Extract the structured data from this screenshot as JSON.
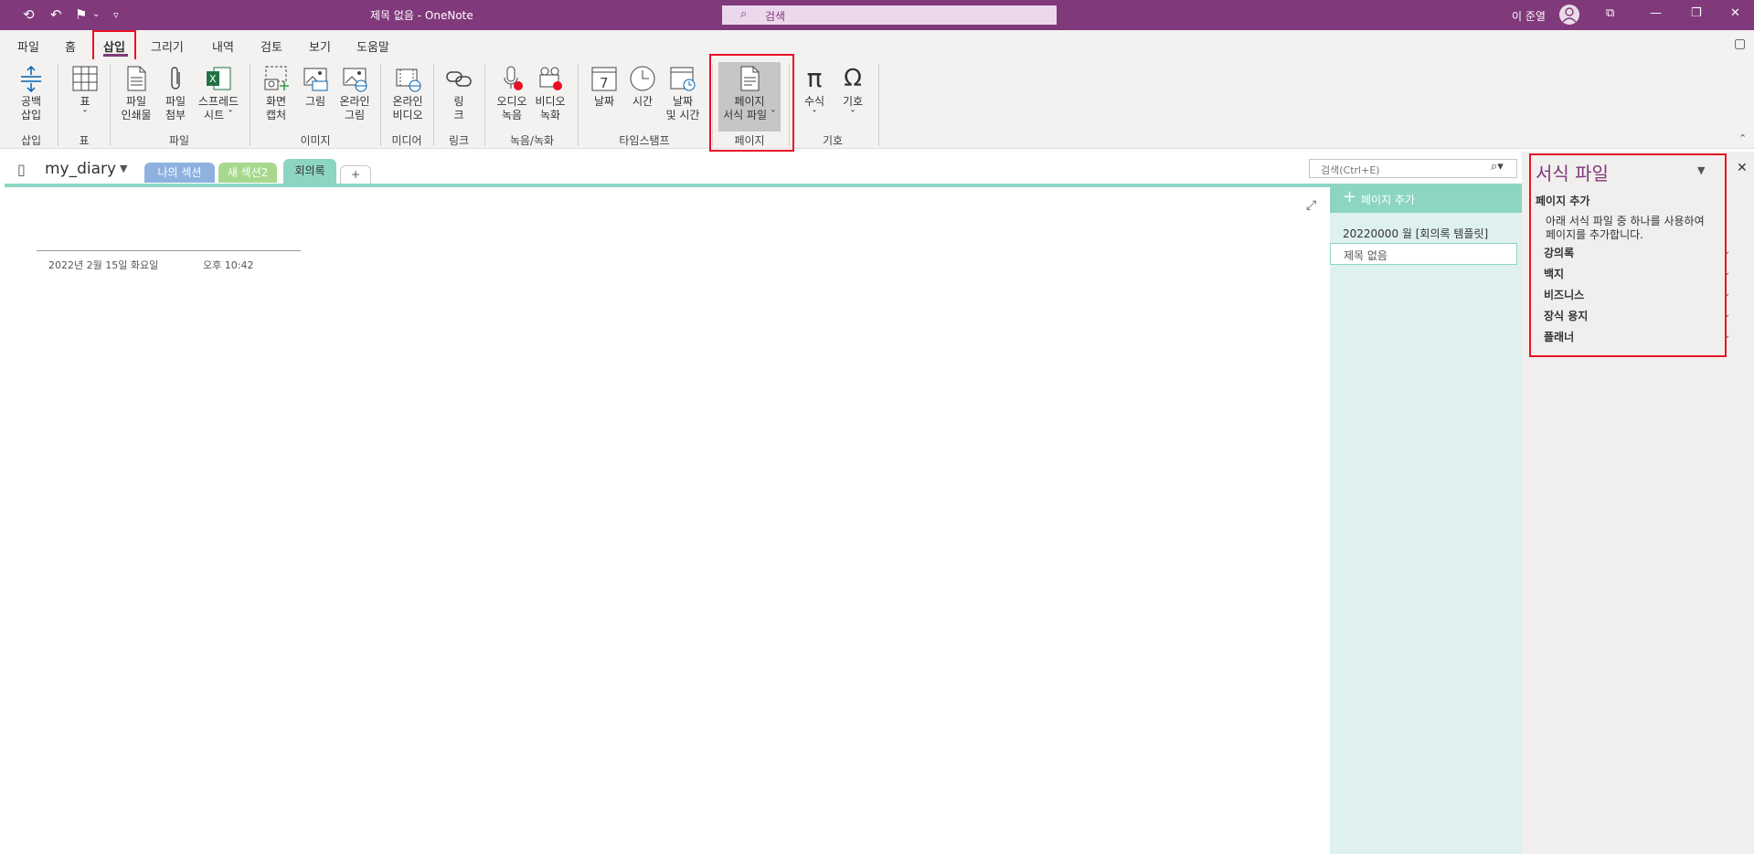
{
  "title_bar": {
    "document_title": "제목 없음  -  OneNote",
    "search_placeholder": "검색",
    "user_name": "이 준열",
    "quick_access": [
      "back-icon",
      "undo-icon",
      "flag-icon",
      "dropdown-icon",
      "customize-icon"
    ]
  },
  "menu_tabs": [
    "파일",
    "홈",
    "삽입",
    "그리기",
    "내역",
    "검토",
    "보기",
    "도움말"
  ],
  "ribbon": {
    "buttons": [
      {
        "label1": "공백",
        "label2": "삽입",
        "icon": "insert-space-icon"
      },
      {
        "label1": "표",
        "label2": "ˇ",
        "icon": "table-icon"
      },
      {
        "label1": "파일",
        "label2": "인쇄물",
        "icon": "file-printout-icon"
      },
      {
        "label1": "파일",
        "label2": "첨부",
        "icon": "attach-file-icon"
      },
      {
        "label1": "스프레드",
        "label2": "시트 ˇ",
        "icon": "spreadsheet-icon"
      },
      {
        "label1": "화면",
        "label2": "캡처",
        "icon": "screen-capture-icon"
      },
      {
        "label1": "그림",
        "label2": "",
        "icon": "picture-icon"
      },
      {
        "label1": "온라인",
        "label2": "그림",
        "icon": "online-picture-icon"
      },
      {
        "label1": "온라인",
        "label2": "비디오",
        "icon": "online-video-icon"
      },
      {
        "label1": "링",
        "label2": "크",
        "icon": "link-icon"
      },
      {
        "label1": "오디오",
        "label2": "녹음",
        "icon": "audio-record-icon"
      },
      {
        "label1": "비디오",
        "label2": "녹화",
        "icon": "video-record-icon"
      },
      {
        "label1": "날짜",
        "label2": "",
        "icon": "date-icon"
      },
      {
        "label1": "시간",
        "label2": "",
        "icon": "time-icon"
      },
      {
        "label1": "날짜",
        "label2": "및 시간",
        "icon": "date-time-icon"
      },
      {
        "label1": "페이지",
        "label2": "서식 파일 ˇ",
        "icon": "page-template-icon"
      },
      {
        "label1": "수식",
        "label2": "ˇ",
        "icon": "equation-icon"
      },
      {
        "label1": "기호",
        "label2": "ˇ",
        "icon": "symbol-icon"
      }
    ],
    "groups": [
      "삽입",
      "표",
      "파일",
      "이미지",
      "미디어",
      "링크",
      "녹음/녹화",
      "타임스탬프",
      "페이지",
      "기호"
    ]
  },
  "notebook": {
    "name": "my_diary",
    "sections": [
      {
        "label": "나의 섹션",
        "color": "#8fb1e0"
      },
      {
        "label": "새 섹션2",
        "color": "#a8d88f"
      },
      {
        "label": "회의록",
        "color": "#8cd5c3"
      }
    ],
    "add_section": "+",
    "search_placeholder": "검색(Ctrl+E)"
  },
  "page": {
    "date": "2022년 2월 15일 화요일",
    "time": "오후 10:42"
  },
  "page_list": {
    "add_page": "페이지 추가",
    "items": [
      "20220000 월 [회의록 템플릿]",
      "제목 없음"
    ]
  },
  "template_pane": {
    "title": "서식 파일",
    "subtitle": "페이지 추가",
    "description_line1": "아래 서식 파일 중 하나를 사용하여",
    "description_line2": "페이지를 추가합니다.",
    "categories": [
      "강의록",
      "백지",
      "비즈니스",
      "장식 용지",
      "플래너"
    ]
  },
  "colors": {
    "accent": "#80397b",
    "section_line": "#8cd5c3",
    "highlight_box": "#e81123"
  }
}
